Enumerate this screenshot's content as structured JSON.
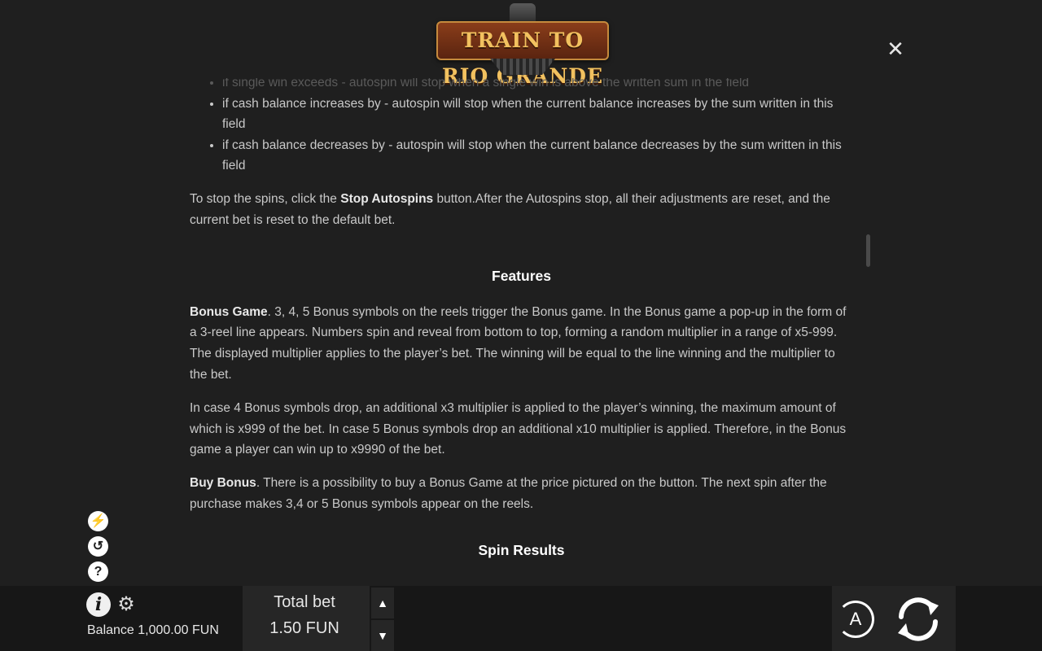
{
  "logo": {
    "text": "TRAIN TO RIO GRANDE"
  },
  "close": {
    "icon": "close-icon",
    "glyph": "✕"
  },
  "rules": {
    "bullet_faded": "if single win exceeds - autospin will stop when a single win is above the written sum in the field",
    "bullets": [
      "if cash balance increases by - autospin will stop when the current balance increases by the sum written in this field",
      "if cash balance decreases by - autospin will stop when the current balance decreases by the sum written in this field"
    ],
    "stop_prefix": "To stop the spins, click the ",
    "stop_bold": "Stop Autospins",
    "stop_suffix": " button.After the Autospins stop, all their adjustments are reset, and the current bet is reset to the default bet."
  },
  "features": {
    "heading": "Features",
    "bonus_game_bold": "Bonus Game",
    "bonus_game_text": ". 3, 4, 5 Bonus symbols on the reels trigger the Bonus game. In the Bonus game a pop-up in the form of a 3-reel line appears. Numbers spin and reveal from bottom to top, forming a random multiplier in a range of x5-999. The displayed multiplier applies to the player’s bet. The winning will be equal to the line winning and the multiplier to the bet.",
    "multiplier_text": "In case 4 Bonus symbols drop, an additional x3 multiplier is applied to the player’s winning, the maximum amount of which is x999 of the bet. In case 5 Bonus symbols drop an additional x10 multiplier is applied. Therefore, in the Bonus game a player can win up to x9990 of the bet.",
    "buy_bonus_bold": "Buy Bonus",
    "buy_bonus_text": ". There is a possibility to buy a Bonus Game at the price pictured on the button. The next spin after the purchase makes 3,4 or 5 Bonus symbols appear on the reels."
  },
  "spin_results": {
    "heading": "Spin Results"
  },
  "side_icons": [
    {
      "name": "turbo-icon",
      "glyph": "⚡"
    },
    {
      "name": "history-icon",
      "glyph": "↺"
    },
    {
      "name": "help-icon",
      "glyph": "?"
    }
  ],
  "bottom_bar": {
    "info_glyph": "i",
    "gear_glyph": "⚙",
    "balance": "Balance 1,000.00 FUN",
    "total_bet_label": "Total bet",
    "total_bet_value": "1.50 FUN",
    "bet_up_glyph": "▲",
    "bet_down_glyph": "▼",
    "autoplay_letter": "A"
  },
  "colors": {
    "background": "#1f1f1f",
    "text": "#c9c9c9",
    "bar": "#171717",
    "logo_gold": "#f2c15f",
    "logo_plate": "#8a3d1a"
  }
}
